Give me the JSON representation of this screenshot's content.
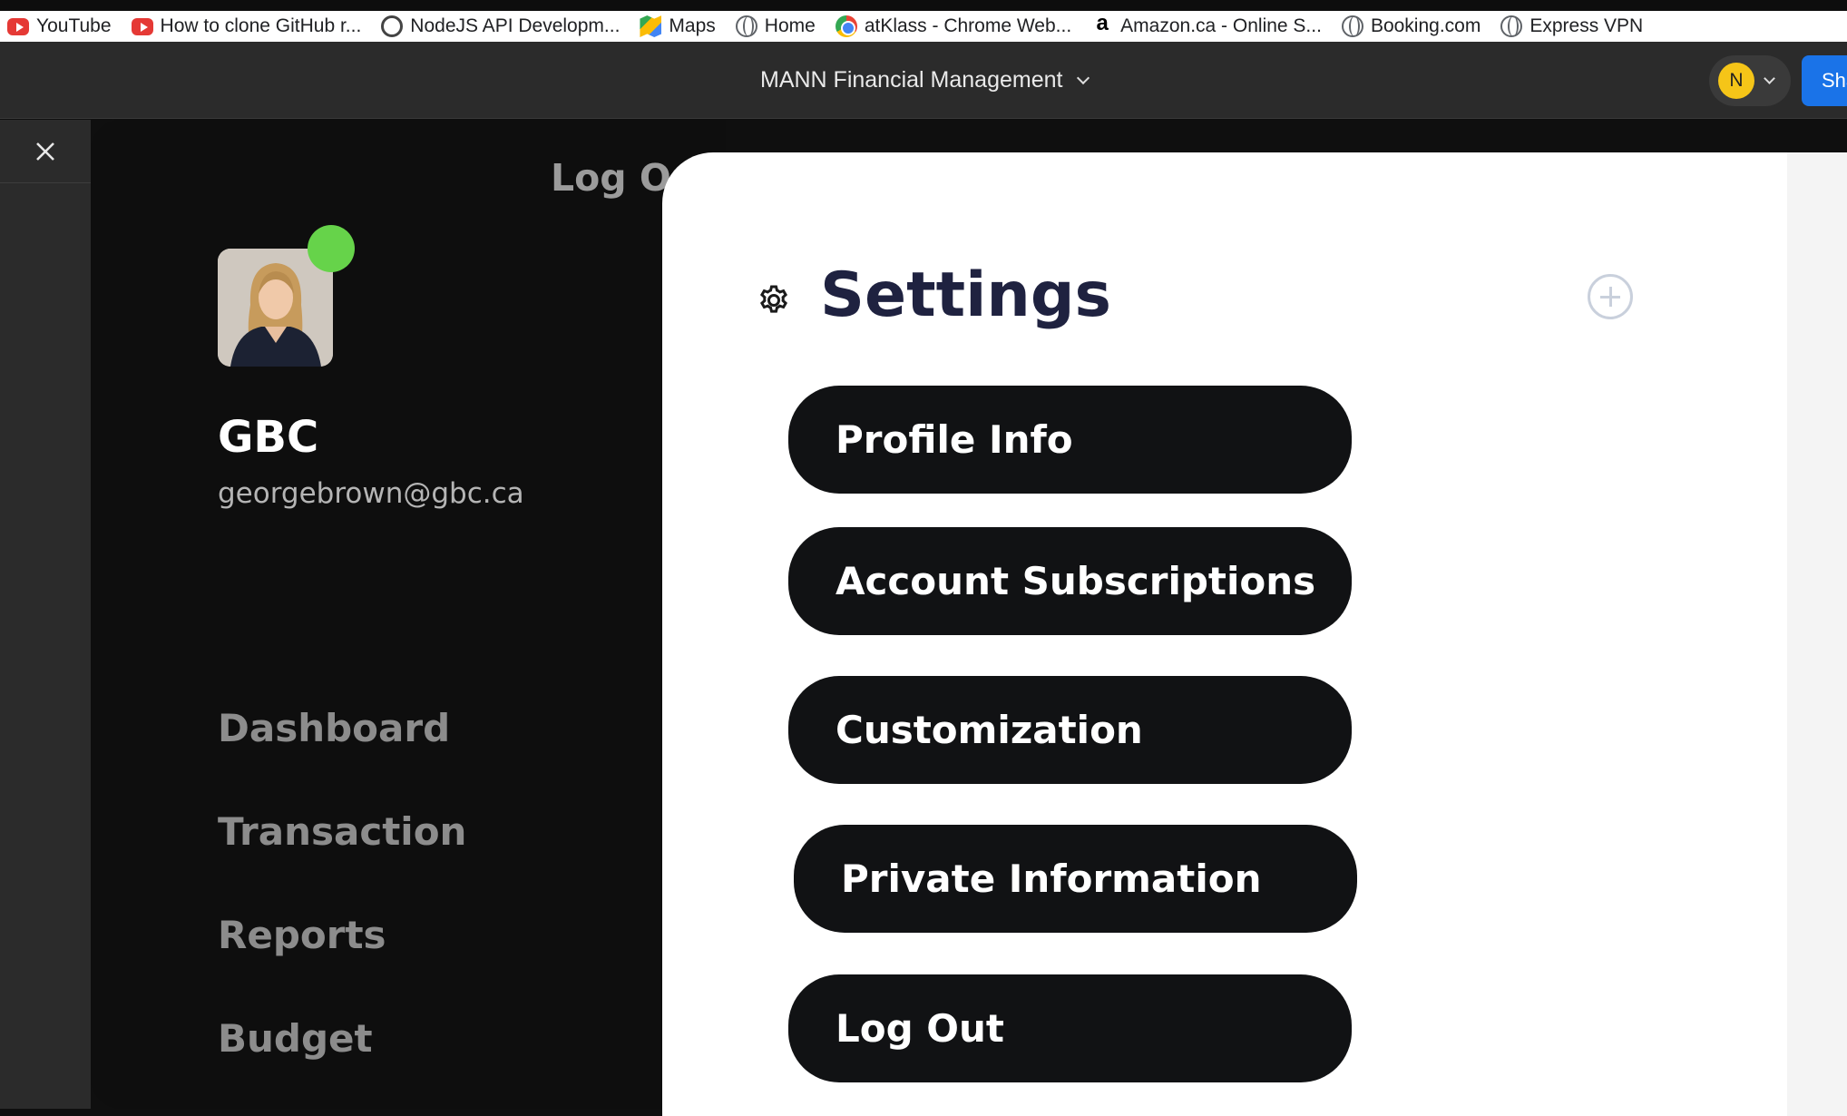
{
  "bookmarks": [
    {
      "label": "YouTube",
      "icon": "youtube-icon"
    },
    {
      "label": "How to clone GitHub r...",
      "icon": "youtube-icon"
    },
    {
      "label": "NodeJS API Developm...",
      "icon": "openai-icon"
    },
    {
      "label": "Maps",
      "icon": "maps-icon"
    },
    {
      "label": "Home",
      "icon": "globe-icon"
    },
    {
      "label": "atKlass - Chrome Web...",
      "icon": "chrome-icon"
    },
    {
      "label": "Amazon.ca - Online S...",
      "icon": "amazon-icon"
    },
    {
      "label": "Booking.com",
      "icon": "globe-icon"
    },
    {
      "label": "Express VPN",
      "icon": "globe-icon"
    }
  ],
  "titlebar": {
    "title": "MANN Financial Management",
    "user_initial": "N",
    "share_label": "Sha"
  },
  "sidebar": {
    "logout_label": "Log Out",
    "user_name": "GBC",
    "user_email": "georgebrown@gbc.ca",
    "status_color": "#66d34a",
    "nav": [
      {
        "label": "Dashboard"
      },
      {
        "label": "Transaction"
      },
      {
        "label": "Reports"
      },
      {
        "label": "Budget"
      }
    ]
  },
  "settings": {
    "title": "Settings",
    "buttons": [
      {
        "label": "Profile Info"
      },
      {
        "label": "Account Subscriptions"
      },
      {
        "label": "Customization"
      },
      {
        "label": "Private Information"
      },
      {
        "label": "Log Out"
      }
    ]
  },
  "colors": {
    "accent_blue": "#1a73e8",
    "title_navy": "#1f2240",
    "pill_black": "#111214"
  }
}
